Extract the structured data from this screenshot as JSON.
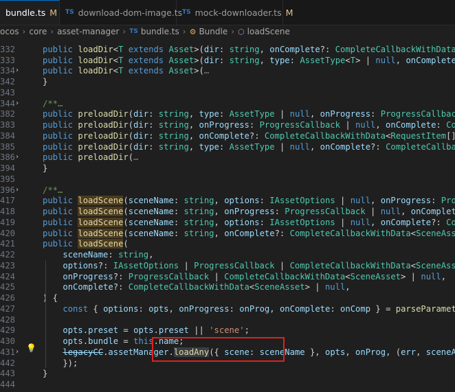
{
  "tabs": [
    {
      "label": "bundle.ts",
      "modified": "M",
      "active": true
    },
    {
      "label": "download-dom-image.ts",
      "modified": "",
      "active": false
    },
    {
      "label": "mock-downloader.ts",
      "modified": "M",
      "active": false
    }
  ],
  "breadcrumb": [
    "ocos",
    "core",
    "asset-manager",
    "bundle.ts",
    "Bundle",
    "loadScene"
  ],
  "ts_badge": "TS",
  "lines": [
    {
      "n": "",
      "txt": ""
    },
    {
      "n": "332",
      "txt": "l1"
    },
    {
      "n": "333",
      "txt": "l2"
    },
    {
      "n": "334",
      "txt": "l3"
    },
    {
      "n": "342",
      "txt": "l4"
    },
    {
      "n": "343",
      "txt": ""
    },
    {
      "n": "344",
      "txt": "l5"
    },
    {
      "n": "382",
      "txt": "l6"
    },
    {
      "n": "383",
      "txt": "l7"
    },
    {
      "n": "384",
      "txt": "l8"
    },
    {
      "n": "385",
      "txt": "l9"
    },
    {
      "n": "386",
      "txt": "l10"
    },
    {
      "n": "394",
      "txt": "l11"
    },
    {
      "n": "395",
      "txt": ""
    },
    {
      "n": "396",
      "txt": "l12"
    },
    {
      "n": "417",
      "txt": "l13"
    },
    {
      "n": "418",
      "txt": "l14"
    },
    {
      "n": "419",
      "txt": "l15"
    },
    {
      "n": "420",
      "txt": "l16"
    },
    {
      "n": "421",
      "txt": "l17"
    },
    {
      "n": "422",
      "txt": "l18"
    },
    {
      "n": "423",
      "txt": "l19"
    },
    {
      "n": "424",
      "txt": "l20"
    },
    {
      "n": "425",
      "txt": "l21"
    },
    {
      "n": "426",
      "txt": "l22"
    },
    {
      "n": "427",
      "txt": "l23"
    },
    {
      "n": "428",
      "txt": ""
    },
    {
      "n": "429",
      "txt": "l24"
    },
    {
      "n": "430",
      "txt": "l25"
    },
    {
      "n": "431",
      "txt": "l26"
    },
    {
      "n": "442",
      "txt": "l27"
    },
    {
      "n": "443",
      "txt": "l28"
    },
    {
      "n": "444",
      "txt": ""
    },
    {
      "n": "445",
      "txt": "l29"
    }
  ],
  "code": {
    "l1": [
      [
        "k",
        "public "
      ],
      [
        "f",
        "loadDir"
      ],
      [
        "o",
        "<"
      ],
      [
        "t",
        "T"
      ],
      [
        "k",
        " extends "
      ],
      [
        "t",
        "Asset"
      ],
      [
        "o",
        ">("
      ],
      [
        "p",
        "dir"
      ],
      [
        "o",
        ": "
      ],
      [
        "t",
        "string"
      ],
      [
        "o",
        ", "
      ],
      [
        "p",
        "onComplete"
      ],
      [
        "o",
        "?: "
      ],
      [
        "t",
        "CompleteCallbackWithData"
      ],
      [
        "o",
        "<"
      ],
      [
        "t",
        "T"
      ],
      [
        "o",
        "[]> | "
      ],
      [
        "k",
        "nul"
      ]
    ],
    "l2": [
      [
        "k",
        "public "
      ],
      [
        "f",
        "loadDir"
      ],
      [
        "o",
        "<"
      ],
      [
        "t",
        "T"
      ],
      [
        "k",
        " extends "
      ],
      [
        "t",
        "Asset"
      ],
      [
        "o",
        ">("
      ],
      [
        "p",
        "dir"
      ],
      [
        "o",
        ": "
      ],
      [
        "t",
        "string"
      ],
      [
        "o",
        ", "
      ],
      [
        "p",
        "type"
      ],
      [
        "o",
        ": "
      ],
      [
        "t",
        "AssetType"
      ],
      [
        "o",
        "<"
      ],
      [
        "t",
        "T"
      ],
      [
        "o",
        "> | "
      ],
      [
        "k",
        "null"
      ],
      [
        "o",
        ", "
      ],
      [
        "p",
        "onComplete"
      ],
      [
        "o",
        "?: "
      ],
      [
        "t",
        "CompleteCa"
      ]
    ],
    "l3": [
      [
        "k",
        "public "
      ],
      [
        "f",
        "loadDir"
      ],
      [
        "o",
        "<"
      ],
      [
        "t",
        "T"
      ],
      [
        "k",
        " extends "
      ],
      [
        "t",
        "Asset"
      ],
      [
        "o",
        ">("
      ],
      [
        "dim",
        "…"
      ]
    ],
    "l4": [
      [
        "o",
        "}"
      ]
    ],
    "l5": [
      [
        "c",
        "/**…"
      ]
    ],
    "l6": [
      [
        "k",
        "public "
      ],
      [
        "f",
        "preloadDir"
      ],
      [
        "o",
        "("
      ],
      [
        "p",
        "dir"
      ],
      [
        "o",
        ": "
      ],
      [
        "t",
        "string"
      ],
      [
        "o",
        ", "
      ],
      [
        "p",
        "type"
      ],
      [
        "o",
        ": "
      ],
      [
        "t",
        "AssetType"
      ],
      [
        "o",
        " | "
      ],
      [
        "k",
        "null"
      ],
      [
        "o",
        ", "
      ],
      [
        "p",
        "onProgress"
      ],
      [
        "o",
        ": "
      ],
      [
        "t",
        "ProgressCallback"
      ],
      [
        "o",
        " | "
      ],
      [
        "k",
        "null"
      ],
      [
        "o",
        ", o"
      ]
    ],
    "l7": [
      [
        "k",
        "public "
      ],
      [
        "f",
        "preloadDir"
      ],
      [
        "o",
        "("
      ],
      [
        "p",
        "dir"
      ],
      [
        "o",
        ": "
      ],
      [
        "t",
        "string"
      ],
      [
        "o",
        ", "
      ],
      [
        "p",
        "onProgress"
      ],
      [
        "o",
        ": "
      ],
      [
        "t",
        "ProgressCallback"
      ],
      [
        "o",
        " | "
      ],
      [
        "k",
        "null"
      ],
      [
        "o",
        ", "
      ],
      [
        "p",
        "onComplete"
      ],
      [
        "o",
        ": "
      ],
      [
        "t",
        "CompleteCallbac"
      ]
    ],
    "l8": [
      [
        "k",
        "public "
      ],
      [
        "f",
        "preloadDir"
      ],
      [
        "o",
        "("
      ],
      [
        "p",
        "dir"
      ],
      [
        "o",
        ": "
      ],
      [
        "t",
        "string"
      ],
      [
        "o",
        ", "
      ],
      [
        "p",
        "onComplete"
      ],
      [
        "o",
        "?: "
      ],
      [
        "t",
        "CompleteCallbackWithData"
      ],
      [
        "o",
        "<"
      ],
      [
        "t",
        "RequestItem"
      ],
      [
        "o",
        "[]> | "
      ],
      [
        "k",
        "null"
      ],
      [
        "o",
        "): v"
      ]
    ],
    "l9": [
      [
        "k",
        "public "
      ],
      [
        "f",
        "preloadDir"
      ],
      [
        "o",
        "("
      ],
      [
        "p",
        "dir"
      ],
      [
        "o",
        ": "
      ],
      [
        "t",
        "string"
      ],
      [
        "o",
        ", "
      ],
      [
        "p",
        "type"
      ],
      [
        "o",
        ": "
      ],
      [
        "t",
        "AssetType"
      ],
      [
        "o",
        " | "
      ],
      [
        "k",
        "null"
      ],
      [
        "o",
        ", "
      ],
      [
        "p",
        "onComplete"
      ],
      [
        "o",
        "?: "
      ],
      [
        "t",
        "CompleteCallbackWithData"
      ],
      [
        "o",
        "<R"
      ]
    ],
    "l10": [
      [
        "k",
        "public "
      ],
      [
        "f",
        "preloadDir"
      ],
      [
        "o",
        "("
      ],
      [
        "dim",
        "…"
      ]
    ],
    "l11": [
      [
        "o",
        "}"
      ]
    ],
    "l12": [
      [
        "c",
        "/**…"
      ]
    ],
    "l13": [
      [
        "k",
        "public "
      ],
      [
        "fh",
        "loadScene"
      ],
      [
        "o",
        "("
      ],
      [
        "p",
        "sceneName"
      ],
      [
        "o",
        ": "
      ],
      [
        "t",
        "string"
      ],
      [
        "o",
        ", "
      ],
      [
        "p",
        "options"
      ],
      [
        "o",
        ": "
      ],
      [
        "t",
        "IAssetOptions"
      ],
      [
        "o",
        " | "
      ],
      [
        "k",
        "null"
      ],
      [
        "o",
        ", "
      ],
      [
        "p",
        "onProgress"
      ],
      [
        "o",
        ": "
      ],
      [
        "t",
        "ProgressCallbac"
      ]
    ],
    "l14": [
      [
        "k",
        "public "
      ],
      [
        "fh",
        "loadScene"
      ],
      [
        "o",
        "("
      ],
      [
        "p",
        "sceneName"
      ],
      [
        "o",
        ": "
      ],
      [
        "t",
        "string"
      ],
      [
        "o",
        ", "
      ],
      [
        "p",
        "onProgress"
      ],
      [
        "o",
        ": "
      ],
      [
        "t",
        "ProgressCallback"
      ],
      [
        "o",
        " | "
      ],
      [
        "k",
        "null"
      ],
      [
        "o",
        ", "
      ],
      [
        "p",
        "onComplete"
      ],
      [
        "o",
        ": "
      ],
      [
        "t",
        "CompleteC"
      ]
    ],
    "l15": [
      [
        "k",
        "public "
      ],
      [
        "fh",
        "loadScene"
      ],
      [
        "o",
        "("
      ],
      [
        "p",
        "sceneName"
      ],
      [
        "o",
        ": "
      ],
      [
        "t",
        "string"
      ],
      [
        "o",
        ", "
      ],
      [
        "p",
        "options"
      ],
      [
        "o",
        ": "
      ],
      [
        "t",
        "IAssetOptions"
      ],
      [
        "o",
        " | "
      ],
      [
        "k",
        "null"
      ],
      [
        "o",
        ", "
      ],
      [
        "p",
        "onComplete"
      ],
      [
        "o",
        "?: "
      ],
      [
        "t",
        "CompleteCallba"
      ]
    ],
    "l16": [
      [
        "k",
        "public "
      ],
      [
        "fh",
        "loadScene"
      ],
      [
        "o",
        "("
      ],
      [
        "p",
        "sceneName"
      ],
      [
        "o",
        ": "
      ],
      [
        "t",
        "string"
      ],
      [
        "o",
        ", "
      ],
      [
        "p",
        "onComplete"
      ],
      [
        "o",
        "?: "
      ],
      [
        "t",
        "CompleteCallbackWithData"
      ],
      [
        "o",
        "<"
      ],
      [
        "t",
        "SceneAsset"
      ],
      [
        "o",
        "> | "
      ],
      [
        "k",
        "null"
      ],
      [
        "o",
        "):"
      ]
    ],
    "l17": [
      [
        "k",
        "public "
      ],
      [
        "fh",
        "loadScene"
      ],
      [
        "o",
        "("
      ]
    ],
    "l18": [
      [
        "o",
        "    "
      ],
      [
        "p",
        "sceneName"
      ],
      [
        "o",
        ": "
      ],
      [
        "t",
        "string"
      ],
      [
        "o",
        ","
      ]
    ],
    "l19": [
      [
        "o",
        "    "
      ],
      [
        "p",
        "options"
      ],
      [
        "o",
        "?: "
      ],
      [
        "t",
        "IAssetOptions"
      ],
      [
        "o",
        " | "
      ],
      [
        "t",
        "ProgressCallback"
      ],
      [
        "o",
        " | "
      ],
      [
        "t",
        "CompleteCallbackWithData"
      ],
      [
        "o",
        "<"
      ],
      [
        "t",
        "SceneAsset"
      ],
      [
        "o",
        "> | "
      ],
      [
        "k",
        "null"
      ],
      [
        "o",
        ","
      ]
    ],
    "l20": [
      [
        "o",
        "    "
      ],
      [
        "p",
        "onProgress"
      ],
      [
        "o",
        "?: "
      ],
      [
        "t",
        "ProgressCallback"
      ],
      [
        "o",
        " | "
      ],
      [
        "t",
        "CompleteCallbackWithData"
      ],
      [
        "o",
        "<"
      ],
      [
        "t",
        "SceneAsset"
      ],
      [
        "o",
        "> | "
      ],
      [
        "k",
        "null"
      ],
      [
        "o",
        ","
      ]
    ],
    "l21": [
      [
        "o",
        "    "
      ],
      [
        "p",
        "onComplete"
      ],
      [
        "o",
        "?: "
      ],
      [
        "t",
        "CompleteCallbackWithData"
      ],
      [
        "o",
        "<"
      ],
      [
        "t",
        "SceneAsset"
      ],
      [
        "o",
        "> | "
      ],
      [
        "k",
        "null"
      ],
      [
        "o",
        ","
      ]
    ],
    "l22": [
      [
        "o",
        ") {"
      ]
    ],
    "l23": [
      [
        "o",
        "    "
      ],
      [
        "k",
        "const "
      ],
      [
        "o",
        "{ "
      ],
      [
        "p",
        "options"
      ],
      [
        "o",
        ": "
      ],
      [
        "p",
        "opts"
      ],
      [
        "o",
        ", "
      ],
      [
        "p",
        "onProgress"
      ],
      [
        "o",
        ": "
      ],
      [
        "p",
        "onProg"
      ],
      [
        "o",
        ", "
      ],
      [
        "p",
        "onComplete"
      ],
      [
        "o",
        ": "
      ],
      [
        "p",
        "onComp"
      ],
      [
        "o",
        " } = "
      ],
      [
        "f",
        "parseParameters"
      ],
      [
        "o",
        "<"
      ],
      [
        "t",
        "Complete"
      ]
    ],
    "l24": [
      [
        "o",
        "    "
      ],
      [
        "p",
        "opts"
      ],
      [
        "o",
        "."
      ],
      [
        "p",
        "preset"
      ],
      [
        "o",
        " = "
      ],
      [
        "p",
        "opts"
      ],
      [
        "o",
        "."
      ],
      [
        "p",
        "preset"
      ],
      [
        "o",
        " || "
      ],
      [
        "s",
        "'scene'"
      ],
      [
        "o",
        ";"
      ]
    ],
    "l25": [
      [
        "o",
        "    "
      ],
      [
        "p",
        "opts"
      ],
      [
        "o",
        "."
      ],
      [
        "p",
        "bundle"
      ],
      [
        "o",
        " = "
      ],
      [
        "k",
        "this"
      ],
      [
        "o",
        "."
      ],
      [
        "p",
        "name"
      ],
      [
        "o",
        ";"
      ]
    ],
    "l26": [
      [
        "o",
        "    "
      ],
      [
        "st",
        "legacyCC"
      ],
      [
        "o",
        "."
      ],
      [
        "p",
        "assetManager"
      ],
      [
        "o",
        "."
      ],
      [
        "fs",
        "loadAny"
      ],
      [
        "o",
        "({ "
      ],
      [
        "p",
        "scene"
      ],
      [
        "o",
        ": "
      ],
      [
        "p",
        "sceneName"
      ],
      [
        "o",
        " }, "
      ],
      [
        "p",
        "opts"
      ],
      [
        "o",
        ", "
      ],
      [
        "p",
        "onProg"
      ],
      [
        "o",
        ", ("
      ],
      [
        "p",
        "err"
      ],
      [
        "o",
        ", "
      ],
      [
        "p",
        "sceneAsset"
      ],
      [
        "o",
        ") "
      ],
      [
        "k",
        "=>"
      ],
      [
        "o",
        " {"
      ],
      [
        "dim",
        "…"
      ]
    ],
    "l27": [
      [
        "o",
        "    });"
      ]
    ],
    "l28": [
      [
        "o",
        "}"
      ]
    ],
    "l29": [
      [
        "c",
        "/**"
      ]
    ]
  }
}
